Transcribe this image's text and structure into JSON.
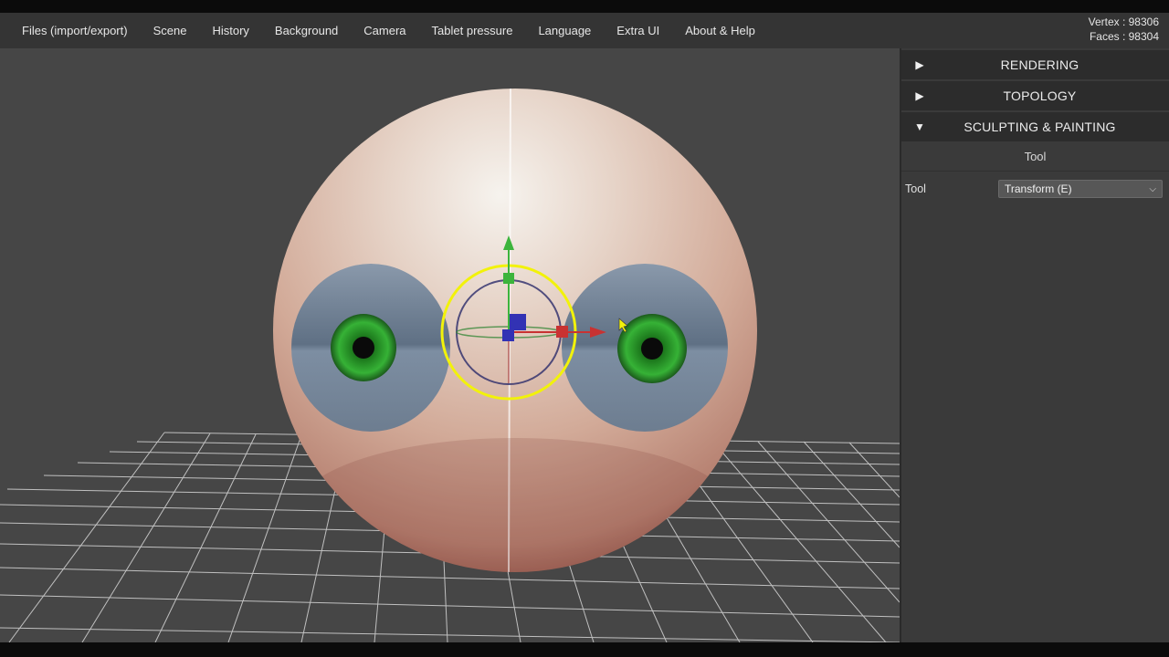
{
  "menu": {
    "items": [
      {
        "label": "Files (import/export)"
      },
      {
        "label": "Scene"
      },
      {
        "label": "History"
      },
      {
        "label": "Background"
      },
      {
        "label": "Camera"
      },
      {
        "label": "Tablet pressure"
      },
      {
        "label": "Language"
      },
      {
        "label": "Extra UI"
      },
      {
        "label": "About & Help"
      }
    ]
  },
  "stats": {
    "vertex": "Vertex : 98306",
    "faces": "Faces : 98304"
  },
  "panel": {
    "sections": [
      {
        "label": "RENDERING",
        "arrow": "▶",
        "expanded": false
      },
      {
        "label": "TOPOLOGY",
        "arrow": "▶",
        "expanded": false
      },
      {
        "label": "SCULPTING & PAINTING",
        "arrow": "▼",
        "expanded": true
      }
    ],
    "tool_header": "Tool",
    "tool_row": {
      "label": "Tool",
      "selected": "Transform (E)"
    }
  },
  "colors": {
    "menubar": "#343434",
    "viewport": "#464646",
    "panel": "#3a3a3a",
    "gizmo_ring": "#f2f20a",
    "axis_x": "#c83232",
    "axis_y": "#3cb43c",
    "axis_z": "#3232b4"
  }
}
